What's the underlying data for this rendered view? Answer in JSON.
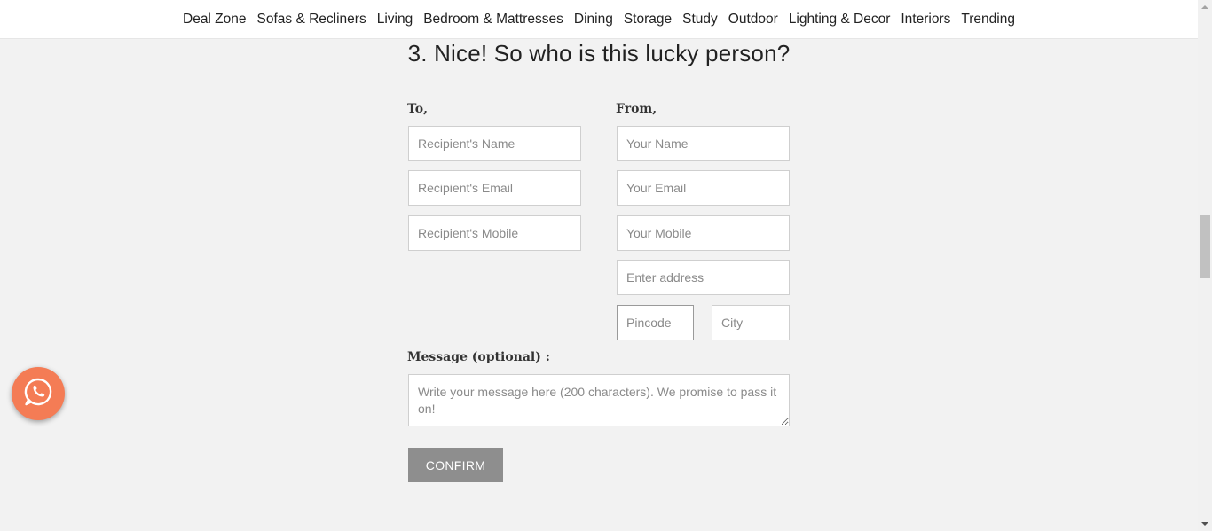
{
  "nav": {
    "items": [
      "Deal Zone",
      "Sofas & Recliners",
      "Living",
      "Bedroom & Mattresses",
      "Dining",
      "Storage",
      "Study",
      "Outdoor",
      "Lighting & Decor",
      "Interiors",
      "Trending"
    ]
  },
  "section": {
    "heading": "3. Nice! So who is this lucky person?"
  },
  "to": {
    "label": "To,",
    "name_placeholder": "Recipient's Name",
    "email_placeholder": "Recipient's Email",
    "mobile_placeholder": "Recipient's Mobile"
  },
  "from": {
    "label": "From,",
    "name_placeholder": "Your Name",
    "email_placeholder": "Your Email",
    "mobile_placeholder": "Your Mobile",
    "address_placeholder": "Enter address",
    "pincode_placeholder": "Pincode",
    "city_placeholder": "City"
  },
  "message": {
    "label": "Message (optional) :",
    "placeholder": "Write your message here (200 characters). We promise to pass it on!"
  },
  "confirm_label": "CONFIRM",
  "whatsapp": {
    "icon": "whatsapp-icon",
    "color": "#f47c55"
  },
  "colors": {
    "accent": "#d9825b",
    "button": "#8e8e8e",
    "background": "#f2f2f2"
  }
}
